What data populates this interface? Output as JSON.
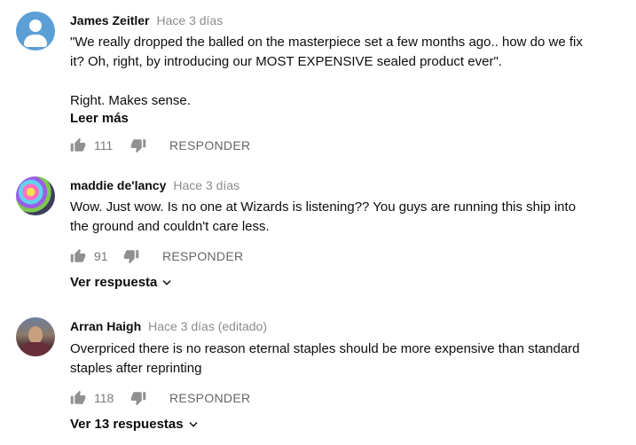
{
  "comments": [
    {
      "author": "James Zeitler",
      "time": "Hace 3 días",
      "text_lines": [
        "\"We really dropped the balled on the masterpiece set a few months ago.. how do we fix",
        "it? Oh, right, by introducing our MOST EXPENSIVE sealed product ever\".",
        "",
        "Right. Makes sense."
      ],
      "read_more": "Leer más",
      "likes": "111",
      "reply_label": "RESPONDER",
      "avatar": "default-user-icon"
    },
    {
      "author": "maddie de'lancy",
      "time": "Hace 3 días",
      "text_lines": [
        "Wow. Just wow. Is no one at Wizards is listening?? You guys are running this ship into",
        "the ground and couldn't care less."
      ],
      "likes": "91",
      "reply_label": "RESPONDER",
      "view_replies": "Ver respuesta",
      "avatar": "art-avatar"
    },
    {
      "author": "Arran Haigh",
      "time": "Hace 3 días (editado)",
      "text_lines": [
        "Overpriced there is no reason eternal staples should be more expensive than standard",
        "staples after reprinting"
      ],
      "likes": "118",
      "reply_label": "RESPONDER",
      "view_replies": "Ver 13 respuestas",
      "avatar": "photo-avatar"
    }
  ],
  "colors": {
    "text": "#0d0d0d",
    "muted": "#8c8c8c",
    "default_avatar": "#5c9fd6"
  }
}
